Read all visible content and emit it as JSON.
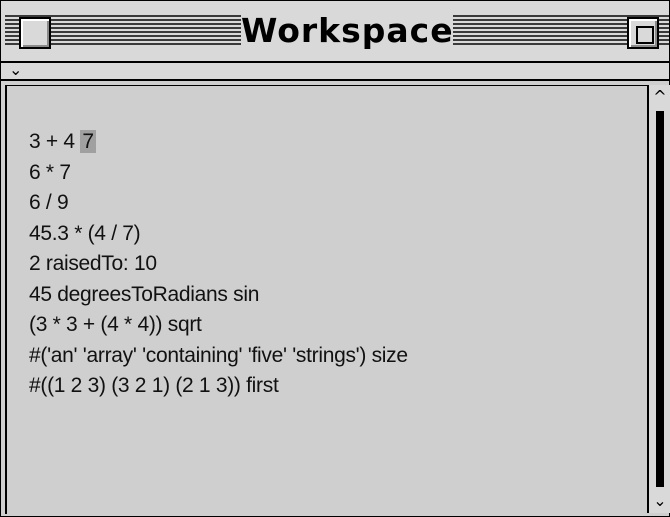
{
  "window": {
    "title": "Workspace"
  },
  "pane": {
    "disclosure_glyph": "⌄"
  },
  "workspace": {
    "lines": [
      {
        "text": "3 + 4 ",
        "result": "7"
      },
      {
        "text": "6 * 7"
      },
      {
        "text": "6 / 9"
      },
      {
        "text": "45.3 * (4 / 7)"
      },
      {
        "text": "2 raisedTo: 10"
      },
      {
        "text": "45 degreesToRadians sin"
      },
      {
        "text": "(3 * 3 + (4 * 4)) sqrt"
      },
      {
        "text": "#('an' 'array' 'containing' 'five' 'strings') size"
      },
      {
        "text": "#((1 2 3) (3 2 1) (2 1 3)) first"
      }
    ]
  },
  "scrollbar": {
    "up_glyph": "^",
    "down_glyph": "⌄"
  },
  "colors": {
    "background": "#cfcfcf",
    "selection": "#a0a0a0"
  }
}
